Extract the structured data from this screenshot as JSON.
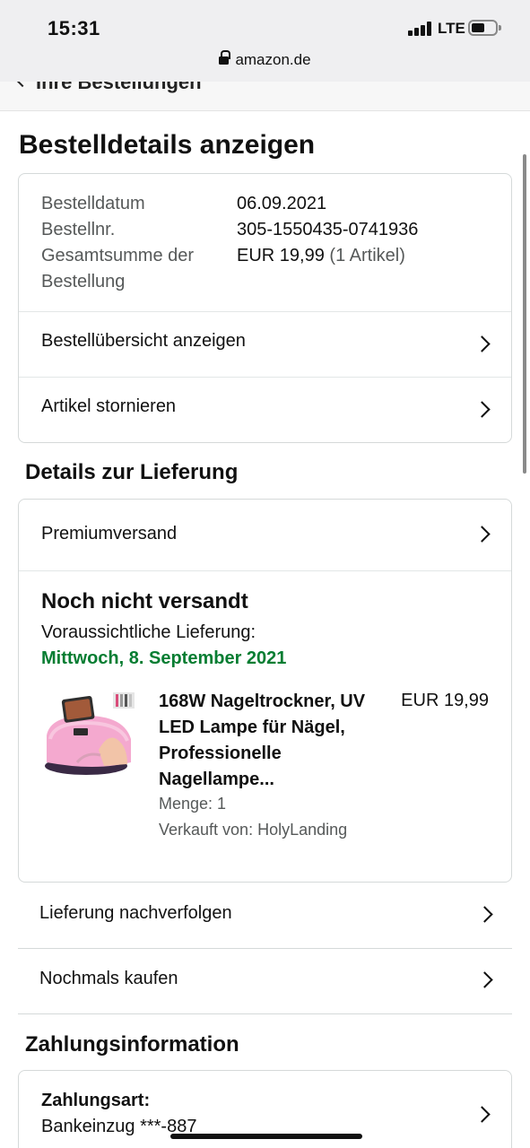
{
  "status_bar": {
    "time": "15:31",
    "network": "LTE"
  },
  "browser": {
    "url": "amazon.de"
  },
  "nav": {
    "back_label": "Ihre Bestellungen"
  },
  "page": {
    "title": "Bestelldetails anzeigen"
  },
  "order_summary": {
    "date_label": "Bestelldatum",
    "date_value": "06.09.2021",
    "number_label": "Bestellnr.",
    "number_value": "305-1550435-0741936",
    "total_label_line1": "Gesamtsumme der",
    "total_label_line2": "Bestellung",
    "total_value": "EUR 19,99",
    "total_items": "(1 Artikel)",
    "actions": [
      {
        "label": "Bestellübersicht anzeigen"
      },
      {
        "label": "Artikel stornieren"
      }
    ]
  },
  "delivery": {
    "heading": "Details zur Lieferung",
    "shipping_method": "Premiumversand",
    "status": "Noch nicht versandt",
    "expected_label": "Voraussichtliche Lieferung:",
    "expected_date": "Mittwoch, 8. September 2021",
    "product": {
      "title": "168W Nageltrockner, UV LED Lampe für Nägel, Professionelle Nagellampe...",
      "price": "EUR 19,99",
      "quantity": "Menge: 1",
      "seller": "Verkauft von: HolyLanding",
      "image_icon": "uv-nail-lamp-product-image"
    },
    "actions": [
      {
        "label": "Lieferung nachverfolgen"
      },
      {
        "label": "Nochmals kaufen"
      }
    ]
  },
  "payment": {
    "heading": "Zahlungsinformation",
    "method_label": "Zahlungsart:",
    "method_value": "Bankeinzug ***-887"
  },
  "colors": {
    "accent_green": "#067d32",
    "border": "#d5d9d9",
    "muted_text": "#565959"
  }
}
